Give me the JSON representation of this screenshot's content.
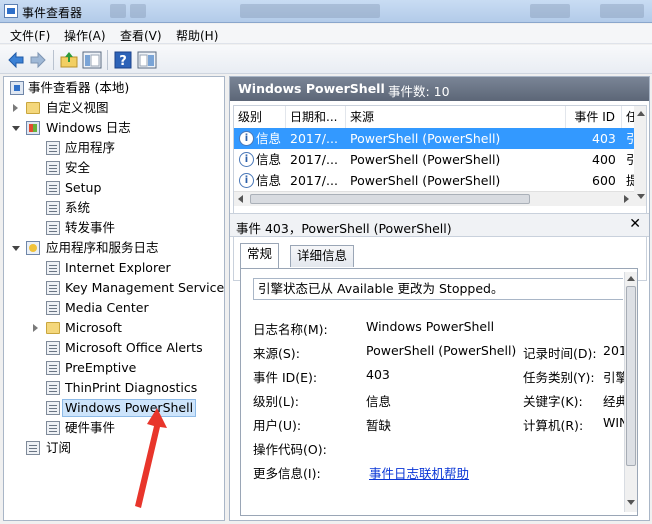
{
  "window": {
    "title": "事件查看器",
    "ghost_title_1": "",
    "ghost_title_2": ""
  },
  "menu": [
    "文件(F)",
    "操作(A)",
    "查看(V)",
    "帮助(H)"
  ],
  "toolbar_icons": [
    "back-arrow-icon",
    "forward-arrow-icon",
    "up-folder-icon",
    "show-hide-tree-icon",
    "help-icon",
    "action-pane-icon"
  ],
  "tree": {
    "root": "事件查看器 (本地)",
    "custom_views": "自定义视图",
    "windows_logs": "Windows 日志",
    "windows_log_items": [
      "应用程序",
      "安全",
      "Setup",
      "系统",
      "转发事件"
    ],
    "app_service_logs": "应用程序和服务日志",
    "app_service_items": [
      "Internet Explorer",
      "Key Management Service",
      "Media Center",
      "Microsoft",
      "Microsoft Office Alerts",
      "PreEmptive",
      "ThinPrint Diagnostics",
      "Windows PowerShell",
      "硬件事件"
    ],
    "subscriptions": "订阅"
  },
  "header": {
    "title": "Windows PowerShell",
    "count": "事件数: 10"
  },
  "list": {
    "columns": [
      "级别",
      "日期和...",
      "来源",
      "事件 ID",
      "任"
    ],
    "rows": [
      {
        "level": "信息",
        "date": "2017/...",
        "source": "PowerShell (PowerShell)",
        "id": "403",
        "task": "引"
      },
      {
        "level": "信息",
        "date": "2017/...",
        "source": "PowerShell (PowerShell)",
        "id": "400",
        "task": "引"
      },
      {
        "level": "信息",
        "date": "2017/...",
        "source": "PowerShell (PowerShell)",
        "id": "600",
        "task": "提"
      }
    ]
  },
  "detail": {
    "title": "事件 403，PowerShell (PowerShell)",
    "close": "✕",
    "tabs": [
      "常规",
      "详细信息"
    ],
    "message": "引擎状态已从 Available 更改为 Stopped。",
    "labels": {
      "log_name": "日志名称(M):",
      "source": "来源(S):",
      "event_id": "事件 ID(E):",
      "level": "级别(L):",
      "user": "用户(U):",
      "opcode": "操作代码(O):",
      "more_info": "更多信息(I):",
      "logged": "记录时间(D):",
      "task": "任务类别(Y):",
      "keywords": "关键字(K):",
      "computer": "计算机(R):"
    },
    "values": {
      "log_name": "Windows PowerShell",
      "source": "PowerShell (PowerShell)",
      "event_id": "403",
      "level": "信息",
      "user": "暂缺",
      "opcode": "",
      "more_info": "事件日志联机帮助",
      "logged": "201",
      "task": "引擎",
      "keywords": "经典",
      "computer": "WIN"
    }
  },
  "colors": {
    "selection": "#3399ff",
    "header": "#5c6677",
    "annotation": "#e8352b",
    "link": "#0a36d6"
  }
}
